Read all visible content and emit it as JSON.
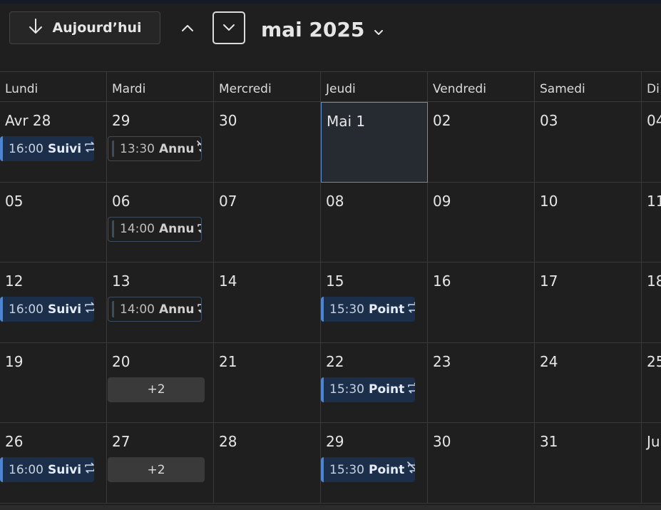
{
  "toolbar": {
    "today_label": "Aujourd’hui",
    "month_label": "mai 2025"
  },
  "weekdays": [
    "Lundi",
    "Mardi",
    "Mercredi",
    "Jeudi",
    "Vendredi",
    "Samedi",
    "Di"
  ],
  "weeks": [
    [
      {
        "date": "Avr 28",
        "events": [
          {
            "time": "16:00",
            "title": "Suivi",
            "icon": "recurring-icon",
            "style": "solid"
          }
        ]
      },
      {
        "date": "29",
        "events": [
          {
            "time": "13:30",
            "title": "Annu",
            "icon": "recurring-cancelled-icon",
            "style": "tentative"
          }
        ]
      },
      {
        "date": "30",
        "events": []
      },
      {
        "date": "Mai 1",
        "today": true,
        "events": []
      },
      {
        "date": "02",
        "events": []
      },
      {
        "date": "03",
        "events": []
      },
      {
        "date": "04",
        "events": []
      }
    ],
    [
      {
        "date": "05",
        "events": []
      },
      {
        "date": "06",
        "events": [
          {
            "time": "14:00",
            "title": "Annu",
            "icon": "recurring-icon",
            "style": "tentative"
          }
        ]
      },
      {
        "date": "07",
        "events": []
      },
      {
        "date": "08",
        "events": []
      },
      {
        "date": "09",
        "events": []
      },
      {
        "date": "10",
        "events": []
      },
      {
        "date": "11",
        "events": []
      }
    ],
    [
      {
        "date": "12",
        "events": [
          {
            "time": "16:00",
            "title": "Suivi",
            "icon": "recurring-icon",
            "style": "solid"
          }
        ]
      },
      {
        "date": "13",
        "events": [
          {
            "time": "14:00",
            "title": "Annu",
            "icon": "recurring-icon",
            "style": "tentative"
          }
        ]
      },
      {
        "date": "14",
        "events": []
      },
      {
        "date": "15",
        "events": [
          {
            "time": "15:30",
            "title": "Point",
            "icon": "recurring-icon",
            "style": "solid"
          }
        ]
      },
      {
        "date": "16",
        "events": []
      },
      {
        "date": "17",
        "events": []
      },
      {
        "date": "18",
        "events": []
      }
    ],
    [
      {
        "date": "19",
        "events": []
      },
      {
        "date": "20",
        "events": [],
        "more": "+2"
      },
      {
        "date": "21",
        "events": []
      },
      {
        "date": "22",
        "events": [
          {
            "time": "15:30",
            "title": "Point",
            "icon": "recurring-icon",
            "style": "solid"
          }
        ]
      },
      {
        "date": "23",
        "events": []
      },
      {
        "date": "24",
        "events": []
      },
      {
        "date": "25",
        "events": []
      }
    ],
    [
      {
        "date": "26",
        "events": [
          {
            "time": "16:00",
            "title": "Suivi",
            "icon": "recurring-icon",
            "style": "solid"
          }
        ]
      },
      {
        "date": "27",
        "events": [],
        "more": "+2"
      },
      {
        "date": "28",
        "events": []
      },
      {
        "date": "29",
        "events": [
          {
            "time": "15:30",
            "title": "Point",
            "icon": "recurring-cancelled-icon",
            "style": "solid"
          }
        ]
      },
      {
        "date": "30",
        "events": []
      },
      {
        "date": "31",
        "events": []
      },
      {
        "date": "Ju",
        "events": []
      }
    ]
  ],
  "colors": {
    "background": "#1f1f1f",
    "event_fill": "#1b2e4a",
    "event_accent": "#4a86d4",
    "today_border": "#5a8fd6"
  }
}
